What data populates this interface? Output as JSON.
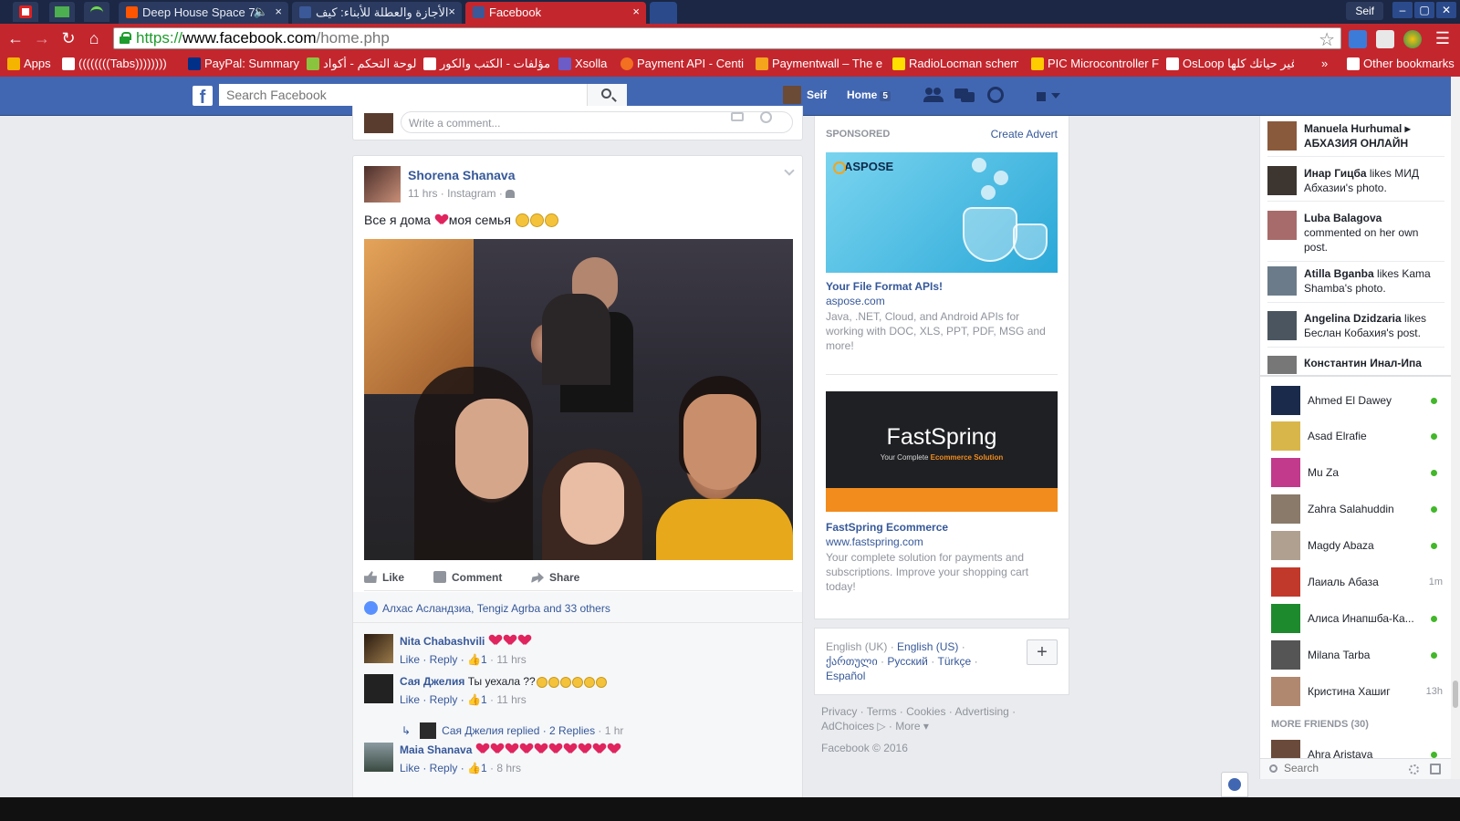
{
  "browser": {
    "tabs": [
      {
        "title": "Deep House Space 78",
        "favicon_color": "#ff5500",
        "close": "×",
        "sound": "🔈"
      },
      {
        "title": "الأجازة والعطلة للأبناء: كيف",
        "favicon_color": "#3b5998",
        "close": "×"
      },
      {
        "title": "Facebook",
        "favicon_color": "#3b5998",
        "close": "×",
        "active": true
      }
    ],
    "profile_name": "Seif",
    "window_buttons": [
      "–",
      "▢",
      "✕"
    ],
    "url": {
      "scheme": "https://",
      "host": "www.facebook.com",
      "path": "/home.php"
    },
    "bookmarks": [
      {
        "label": "Apps",
        "color": "#f4b400"
      },
      {
        "label": "((((((((Tabs))))))))",
        "color": "#ffffff"
      },
      {
        "label": "PayPal: Summary",
        "color": "#003087"
      },
      {
        "label": "لوحة التحكم - أكواد",
        "color": "#8ac43f"
      },
      {
        "label": "مؤلفات - الكتب والكور",
        "color": "#ffffff"
      },
      {
        "label": "Xsolla",
        "color": "#6b5cc7"
      },
      {
        "label": "Payment API - Centi",
        "color": "#f36f21"
      },
      {
        "label": "Paymentwall – The e",
        "color": "#f4a51c"
      },
      {
        "label": "RadioLocman schem",
        "color": "#ffde00"
      },
      {
        "label": "PIC Microcontroller F",
        "color": "#ffcc00"
      },
      {
        "label": "OsLoop غير حياتك كلها",
        "color": "#ffffff"
      }
    ],
    "bookmarks_more": "»",
    "other_bookmarks": "Other bookmarks"
  },
  "fb_header": {
    "logo": "f",
    "search_placeholder": "Search Facebook",
    "user_name": "Seif",
    "home_label": "Home",
    "home_count": "5"
  },
  "top_card": {
    "comment_placeholder": "Write a comment..."
  },
  "post": {
    "author": "Shorena Shanava",
    "meta": "11 hrs · Instagram · ",
    "text_before": "Все я дома ",
    "text_after": "моя семья ",
    "actions": {
      "like": "Like",
      "comment": "Comment",
      "share": "Share"
    },
    "likes_summary": "Алхас Асландзиа, Tengiz Agrba and 33 others",
    "comments": [
      {
        "name": "Nita Chabashvili",
        "text": "",
        "hearts": 3,
        "actions": "Like · Reply · ",
        "likes": "1",
        "time": " · 11 hrs"
      },
      {
        "name": "Сая Джелия",
        "text": "Ты уехала ??",
        "emojis": 6,
        "actions": "Like · Reply · ",
        "likes": "1",
        "time": " · 11 hrs"
      },
      {
        "name": "Maia Shanava",
        "text": "",
        "hearts": 10,
        "actions": "Like · Reply · ",
        "likes": "1",
        "time": " · 8 hrs"
      }
    ],
    "reply": {
      "name": "Сая Джелия",
      "text": "replied · ",
      "count": "2 Replies",
      "time": " · 1 hr"
    }
  },
  "ads": {
    "sponsored": "SPONSORED",
    "create": "Create Advert",
    "items": [
      {
        "brand": "ASPOSE",
        "title": "Your File Format APIs!",
        "url": "aspose.com",
        "desc": "Java, .NET, Cloud, and Android APIs for working with DOC, XLS, PPT, PDF, MSG and more!"
      },
      {
        "brand": "FastSpring",
        "tagline_a": "Your Complete ",
        "tagline_b": "Ecommerce Solution",
        "title": "FastSpring Ecommerce",
        "url": "www.fastspring.com",
        "desc": "Your complete solution for payments and subscriptions. Improve your shopping cart today!"
      }
    ]
  },
  "languages": {
    "current": "English (UK)",
    "others": [
      "English (US)",
      "ქართული",
      "Русский",
      "Türkçe",
      "Español"
    ],
    "sep": " · ",
    "add": "+"
  },
  "footer": {
    "links": "Privacy · Terms · Cookies · Advertising · AdChoices ▷ · More ▾",
    "copyright": "Facebook © 2016"
  },
  "ticker": [
    {
      "bold": "Manuela Hurhumal ▸ АБХАЗИЯ ОНЛАЙН",
      "rest": "",
      "color": "#8a5a3c"
    },
    {
      "bold": "Инар Гицба",
      "rest": " likes МИД Абхазии's photo.",
      "color": "#3d3530"
    },
    {
      "bold": "Luba Balagova",
      "rest": " commented on her own post.",
      "color": "#a86b6b"
    },
    {
      "bold": "Atilla Bganba",
      "rest": " likes Kama Shamba's photo.",
      "color": "#6b7b8a"
    },
    {
      "bold": "Angelina Dzidzaria",
      "rest": " likes Беслан Кобахия's post.",
      "color": "#4a5560"
    },
    {
      "bold": "Константин Инал-Ипа",
      "rest": "",
      "color": "#777777"
    }
  ],
  "chat": {
    "friends": [
      {
        "name": "Ahmed El Dawey",
        "status": "online",
        "color": "#1a2a4a"
      },
      {
        "name": "Asad Elrafie",
        "status": "online",
        "color": "#d9b64a"
      },
      {
        "name": "Mu Za",
        "status": "online",
        "color": "#c23a8c"
      },
      {
        "name": "Zahra Salahuddin",
        "status": "online",
        "color": "#8a7a6a"
      },
      {
        "name": "Magdy Abaza",
        "status": "online",
        "color": "#b0a090"
      },
      {
        "name": "Лаиаль Абаза",
        "status": "1m",
        "color": "#c0392b"
      },
      {
        "name": "Алиса Инапшба-Ка...",
        "status": "online",
        "color": "#1e8a2e"
      },
      {
        "name": "Milana Tarba",
        "status": "online",
        "color": "#555555"
      },
      {
        "name": "Кристина Хашиг",
        "status": "13h",
        "color": "#b08870"
      }
    ],
    "more_friends": "MORE FRIENDS (30)",
    "more_list": [
      {
        "name": "Ahra Aristava",
        "status": "online",
        "color": "#6a4a3a"
      }
    ],
    "search_placeholder": "Search"
  }
}
